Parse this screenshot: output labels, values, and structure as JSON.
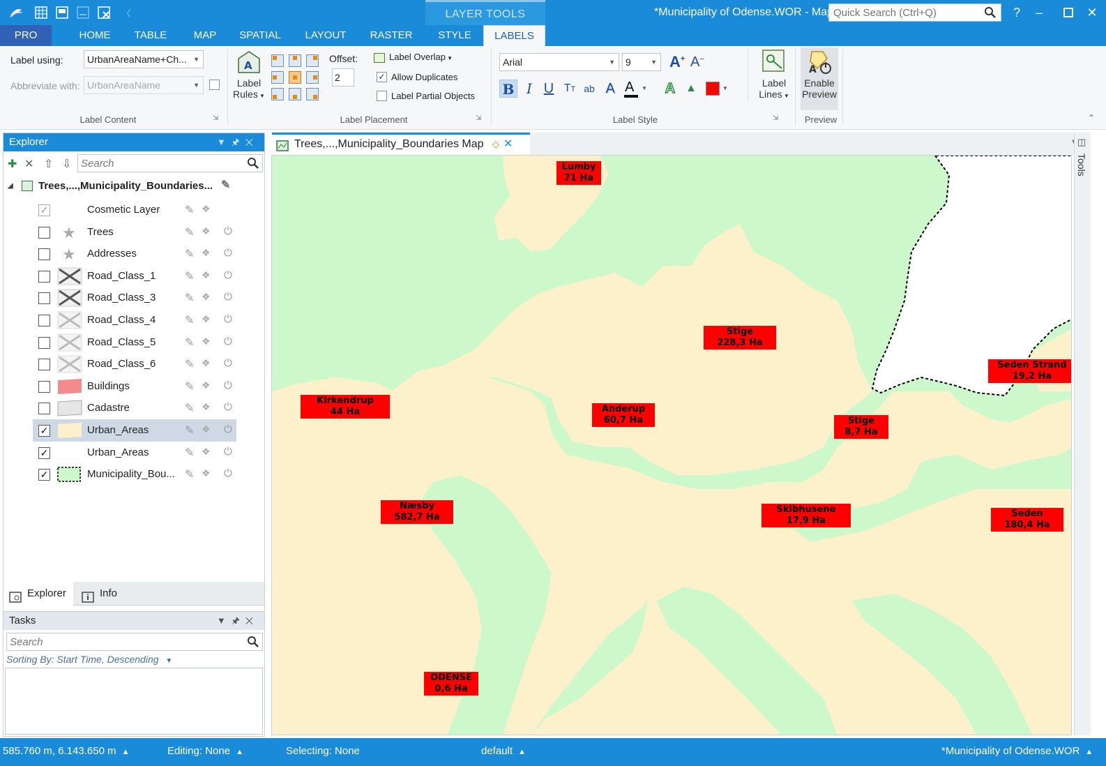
{
  "window": {
    "title": "*Municipality of Odense.WOR - MapInfo Pro",
    "context_group": "LAYER TOOLS",
    "quick_search_placeholder": "Quick Search (Ctrl+Q)"
  },
  "tabs": [
    "PRO",
    "HOME",
    "TABLE",
    "MAP",
    "SPATIAL",
    "LAYOUT",
    "RASTER",
    "STYLE",
    "LABELS"
  ],
  "active_tab": "LABELS",
  "ribbon": {
    "label_content": {
      "group_label": "Label Content",
      "label_using_label": "Label using:",
      "label_using_value": "UrbanAreaName+Ch...",
      "abbreviate_label": "Abbreviate with:",
      "abbreviate_value": "UrbanAreaName"
    },
    "label_rules": {
      "line1": "Label",
      "line2": "Rules"
    },
    "label_placement": {
      "group_label": "Label Placement",
      "offset_label": "Offset:",
      "offset_value": "2",
      "label_overlap": "Label Overlap",
      "allow_duplicates": "Allow Duplicates",
      "allow_duplicates_checked": true,
      "label_partial_objects": "Label Partial Objects",
      "label_partial_objects_checked": false
    },
    "label_style": {
      "group_label": "Label Style",
      "font": "Arial",
      "size": "9",
      "color": "#ff0000"
    },
    "label_lines": {
      "line1": "Label",
      "line2": "Lines"
    },
    "preview": {
      "group_label": "Preview",
      "line1": "Enable",
      "line2": "Preview"
    }
  },
  "explorer": {
    "title": "Explorer",
    "search_placeholder": "Search",
    "map_name": "Trees,...,Municipality_Boundaries...",
    "layers": [
      {
        "name": "Cosmetic Layer",
        "checked": true,
        "disabled": true,
        "symbol": "none"
      },
      {
        "name": "Trees",
        "checked": false,
        "symbol": "star-icon"
      },
      {
        "name": "Addresses",
        "checked": false,
        "symbol": "star-icon"
      },
      {
        "name": "Road_Class_1",
        "checked": false,
        "symbol": "road-dark-icon"
      },
      {
        "name": "Road_Class_3",
        "checked": false,
        "symbol": "road-dark-icon"
      },
      {
        "name": "Road_Class_4",
        "checked": false,
        "symbol": "road-light-icon"
      },
      {
        "name": "Road_Class_5",
        "checked": false,
        "symbol": "road-light-icon"
      },
      {
        "name": "Road_Class_6",
        "checked": false,
        "symbol": "road-light-icon"
      },
      {
        "name": "Buildings",
        "checked": false,
        "symbol": "pink-region-icon"
      },
      {
        "name": "Cadastre",
        "checked": false,
        "symbol": "grey-region-icon"
      },
      {
        "name": "Urban_Areas",
        "checked": true,
        "selected": true,
        "symbol": "beige-region-icon"
      },
      {
        "name": "Urban_Areas",
        "checked": true,
        "symbol": "none"
      },
      {
        "name": "Municipality_Bou...",
        "checked": true,
        "symbol": "dashed-green-region-icon"
      }
    ],
    "bottom_tabs": [
      "Explorer",
      "Info"
    ]
  },
  "tasks": {
    "title": "Tasks",
    "search_placeholder": "Search",
    "sorting": "Sorting By: Start Time, Descending"
  },
  "document_tab": {
    "title": "Trees,...,Municipality_Boundaries Map"
  },
  "tools_label": "Tools",
  "map": {
    "colors": {
      "background": "#ccf8cc",
      "urban": "#fdf1cc",
      "label_box": "#ff0000"
    },
    "labels": [
      {
        "name": "Lumby",
        "area": "71 Ha"
      },
      {
        "name": "Stige",
        "area": "228,3 Ha"
      },
      {
        "name": "Seden Strand",
        "area": "19,2 Ha"
      },
      {
        "name": "Kirkendrup",
        "area": "44 Ha"
      },
      {
        "name": "Anderup",
        "area": "60,7 Ha"
      },
      {
        "name": "Stige",
        "area": "8,7 Ha"
      },
      {
        "name": "Næsby",
        "area": "582,7 Ha"
      },
      {
        "name": "Skibhusene",
        "area": "17,9 Ha"
      },
      {
        "name": "Seden",
        "area": "180,4 Ha"
      },
      {
        "name": "ODENSE",
        "area": "0,6 Ha"
      }
    ]
  },
  "status": {
    "coords": "585.760 m, 6.143.650 m",
    "editing": "Editing: None",
    "selecting": "Selecting: None",
    "style": "default",
    "workspace": "*Municipality of Odense.WOR"
  }
}
